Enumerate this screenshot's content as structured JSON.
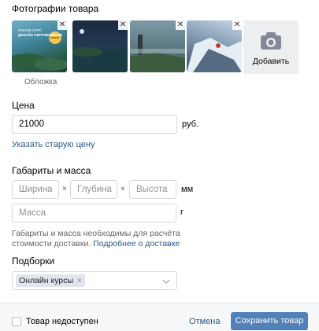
{
  "photos": {
    "title": "Фотографии товара",
    "cover_label": "Обложка",
    "add_label": "Добавить",
    "cover_overlay": {
      "line1": "ONLINE-КУРС",
      "line2": "ДИЗАЙН ОКРУЖЕНИЯ 3D",
      "badge": "Новый"
    }
  },
  "price": {
    "title": "Цена",
    "value": "21000",
    "currency": "руб.",
    "old_price_link": "Указать старую цену"
  },
  "dimensions": {
    "title": "Габариты и масса",
    "width_placeholder": "Ширина",
    "depth_placeholder": "Глубина",
    "height_placeholder": "Высота",
    "times": "×",
    "unit_mm": "мм",
    "mass_placeholder": "Масса",
    "unit_g": "г",
    "hint_line1": "Габариты и масса необходимы для расчёта",
    "hint_line2": "стоимости доставки.",
    "hint_link": "Подробнее о доставке"
  },
  "collections": {
    "title": "Подборки",
    "tag": "Онлайн курсы",
    "tag_remove": "×"
  },
  "footer": {
    "unavailable_label": "Товар недоступен",
    "cancel_label": "Отмена",
    "save_label": "Сохранить товар"
  },
  "colors": {
    "link": "#2a5885",
    "primary_button": "#5181b8",
    "input_border": "#d3d9de",
    "footer_bg": "#f7f8fa"
  },
  "icons": [
    "close-icon",
    "camera-icon",
    "chevron-down-icon",
    "checkbox-icon"
  ]
}
